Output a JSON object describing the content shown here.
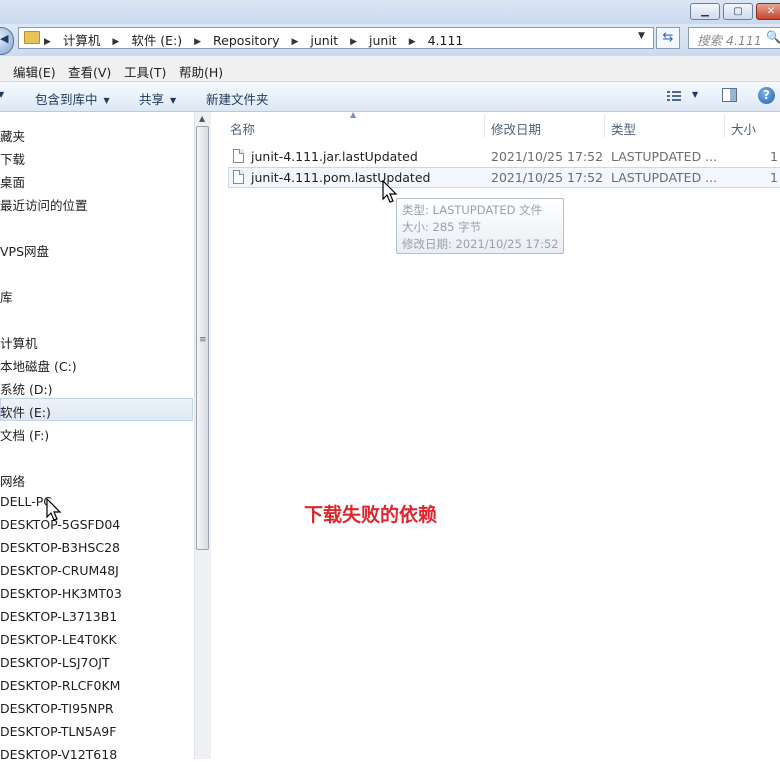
{
  "window": {
    "minimize_glyph": "▁",
    "maximize_glyph": "▢",
    "close_glyph": "✕"
  },
  "address_bar": {
    "crumbs": [
      "计算机",
      "软件 (E:)",
      "Repository",
      "junit",
      "junit",
      "4.111"
    ],
    "separator": "▶"
  },
  "search": {
    "placeholder": "搜索 4.111"
  },
  "menu": {
    "items": [
      "编辑(E)",
      "查看(V)",
      "工具(T)",
      "帮助(H)"
    ]
  },
  "toolbar": {
    "include_library": "包含到库中",
    "share": "共享",
    "new_folder": "新建文件夹",
    "help_glyph": "?"
  },
  "nav": {
    "items": [
      {
        "label": "藏夹"
      },
      {
        "label": "下载"
      },
      {
        "label": "桌面"
      },
      {
        "label": "最近访问的位置"
      },
      {
        "label": "VPS网盘"
      },
      {
        "label": "库"
      },
      {
        "label": "计算机"
      },
      {
        "label": "本地磁盘 (C:)"
      },
      {
        "label": "系统 (D:)"
      },
      {
        "label": "软件 (E:)",
        "selected": true
      },
      {
        "label": "文档 (F:)"
      },
      {
        "label": "网络"
      },
      {
        "label": "DELL-PC"
      },
      {
        "label": "DESKTOP-5GSFD04"
      },
      {
        "label": "DESKTOP-B3HSC28"
      },
      {
        "label": "DESKTOP-CRUM48J"
      },
      {
        "label": "DESKTOP-HK3MT03"
      },
      {
        "label": "DESKTOP-L3713B1"
      },
      {
        "label": "DESKTOP-LE4T0KK"
      },
      {
        "label": "DESKTOP-LSJ7OJT"
      },
      {
        "label": "DESKTOP-RLCF0KM"
      },
      {
        "label": "DESKTOP-TI95NPR"
      },
      {
        "label": "DESKTOP-TLN5A9F"
      },
      {
        "label": "DESKTOP-V12T618"
      }
    ]
  },
  "columns": {
    "name": "名称",
    "modified": "修改日期",
    "type": "类型",
    "size": "大小"
  },
  "files": [
    {
      "name": "junit-4.111.jar.lastUpdated",
      "modified": "2021/10/25 17:52",
      "type": "LASTUPDATED ...",
      "size": "1"
    },
    {
      "name": "junit-4.111.pom.lastUpdated",
      "modified": "2021/10/25 17:52",
      "type": "LASTUPDATED ...",
      "size": "1"
    }
  ],
  "tooltip": {
    "type_line": "类型: LASTUPDATED 文件",
    "size_line": "大小: 285 字节",
    "date_line": "修改日期: 2021/10/25 17:52"
  },
  "annotation": "下载失败的依赖"
}
